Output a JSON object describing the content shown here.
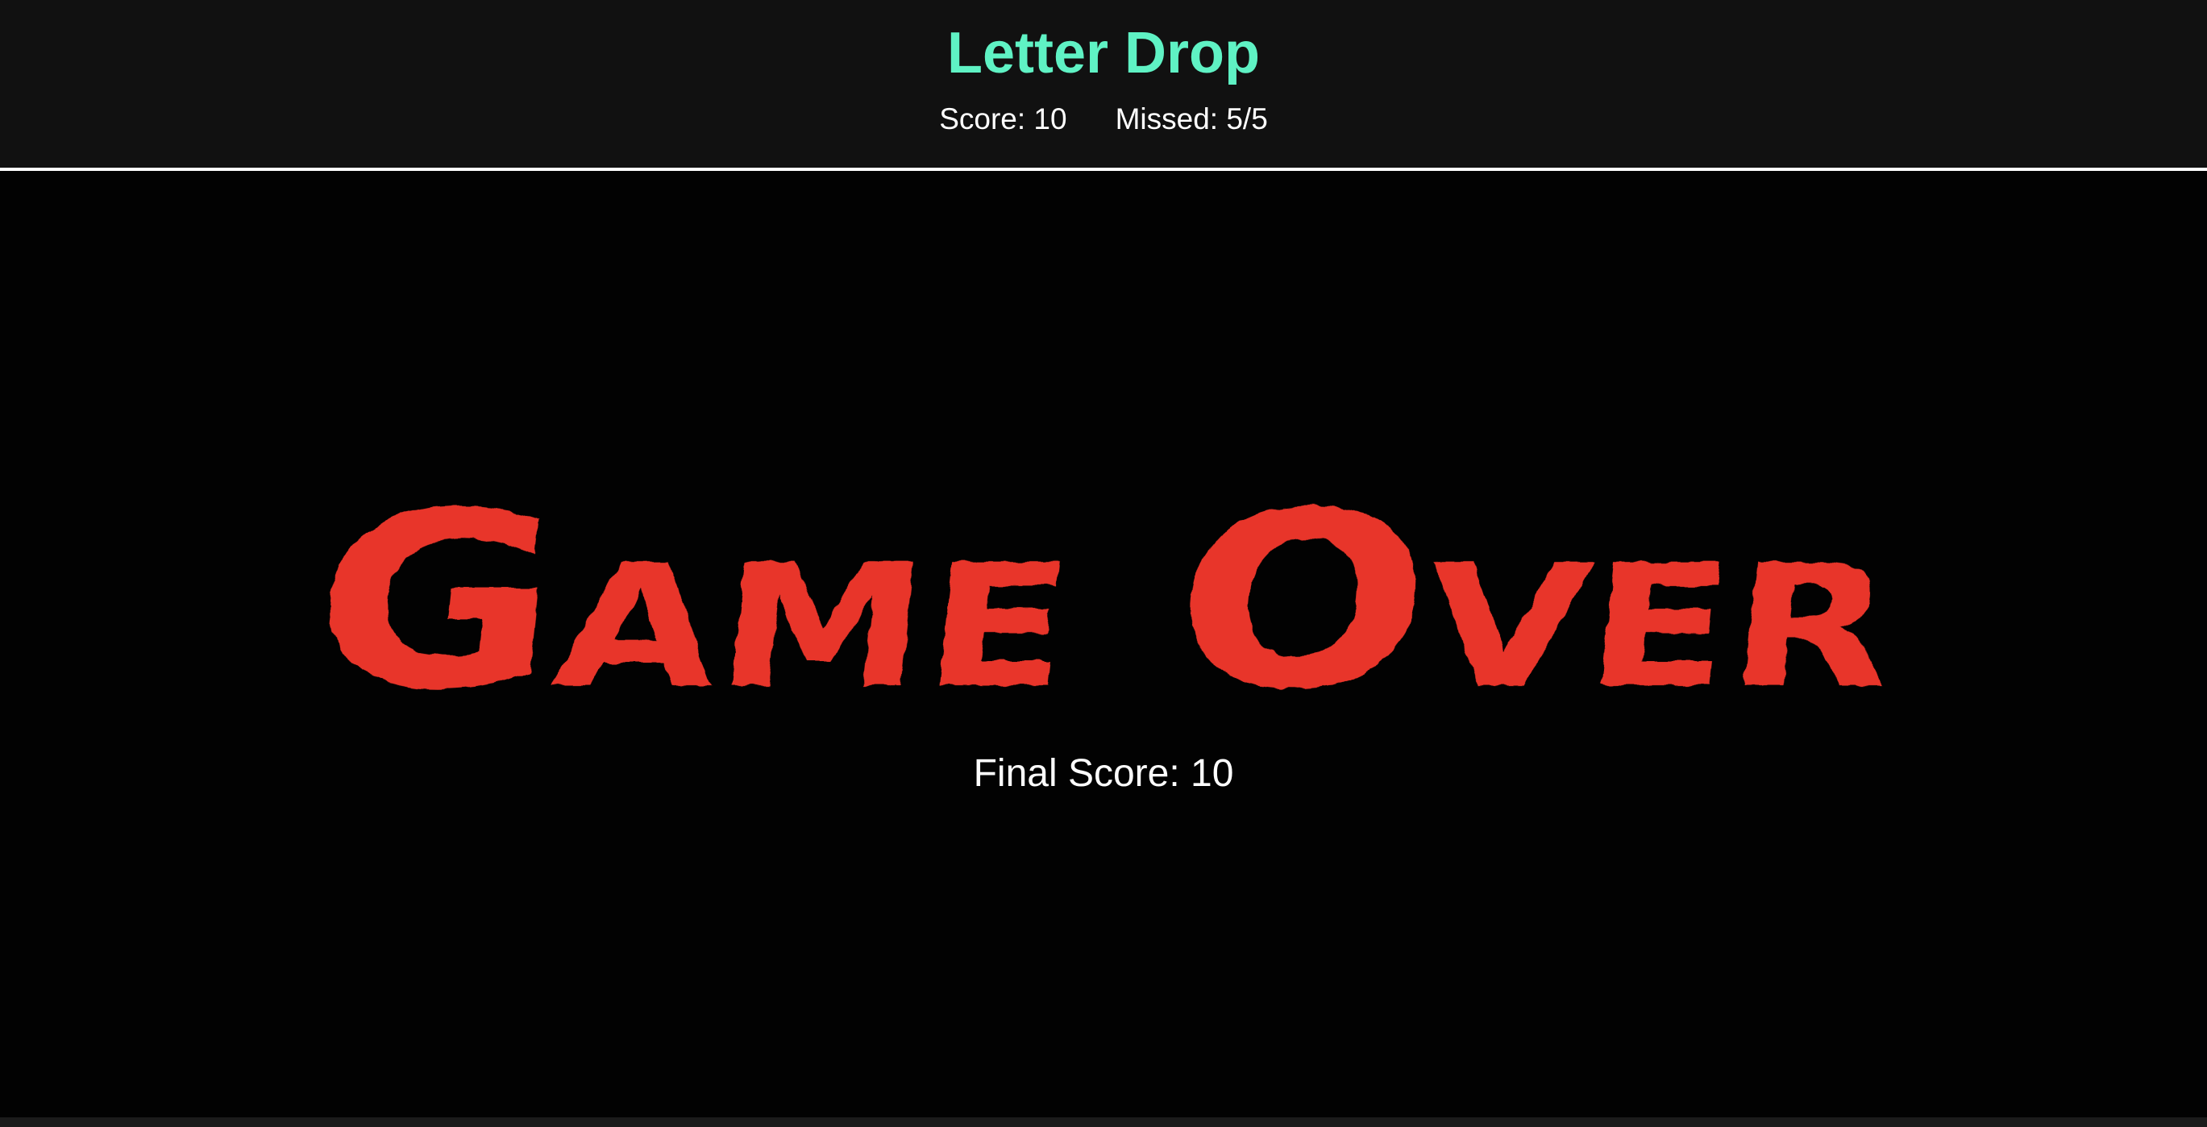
{
  "header": {
    "title": "Letter Drop",
    "score_text": "Score: 10",
    "missed_text": "Missed: 5/5"
  },
  "game": {
    "game_over_text": "Game Over",
    "final_score_text": "Final Score: 10",
    "score": 10,
    "missed": 5,
    "max_missed": 5
  },
  "colors": {
    "title": "#5ff2c4",
    "game_over": "#e8342a",
    "background": "#020202",
    "header_background": "#111111",
    "text": "#ffffff"
  }
}
